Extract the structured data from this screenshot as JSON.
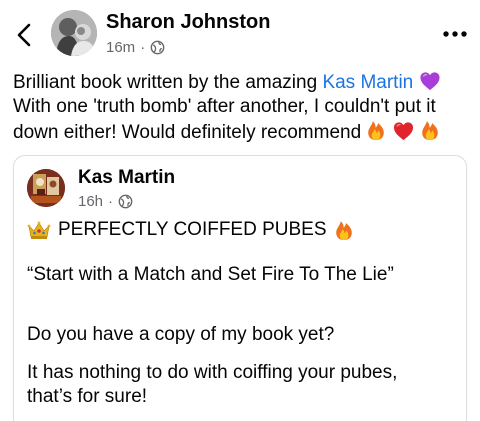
{
  "post": {
    "author_name": "Sharon Johnston",
    "timestamp": "16m",
    "separator": "·",
    "audience_icon": "globe-icon",
    "text_line1_before": "Brilliant book written by the amazing ",
    "mention": "Kas Martin",
    "text_line2": "With one 'truth bomb' after another, I couldn't put it",
    "text_line3": "down either! Would definitely recommend"
  },
  "shared_post": {
    "author_name": "Kas Martin",
    "timestamp": "16h",
    "separator": "·",
    "audience_icon": "globe-icon",
    "headline": "PERFECTLY COIFFED PUBES",
    "quote": "“Start with a Match and Set Fire To The Lie”",
    "question": "Do you have a copy of my book yet?",
    "line4": "It has nothing to do with coiffing your pubes,",
    "line5": "that’s for sure!"
  },
  "icons": {
    "back": "chevron-left-icon",
    "more": "more-horizontal-icon",
    "heart": "purple-heart-icon",
    "fire": "fire-icon",
    "red_heart": "red-heart-icon",
    "crown": "crown-icon"
  },
  "colors": {
    "mention": "#1b74e4",
    "meta_text": "#65676b",
    "purple_heart": "#a93dd8",
    "red_heart": "#e0242d",
    "fire_outer": "#f0711d",
    "fire_inner": "#fcc21b",
    "crown": "#e8b21c"
  }
}
